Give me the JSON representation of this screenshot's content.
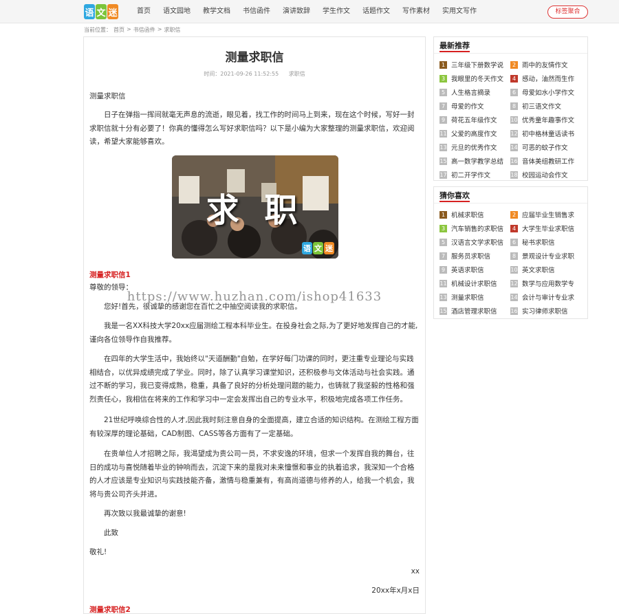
{
  "logo": {
    "chars": [
      "语",
      "文",
      "迷"
    ],
    "colors": [
      "#2fa8e0",
      "#7cc43a",
      "#f08a24"
    ]
  },
  "nav": {
    "items": [
      "首页",
      "语文园地",
      "教学文档",
      "书信函件",
      "演讲致辞",
      "学生作文",
      "话题作文",
      "写作素材",
      "实用文写作"
    ],
    "login_label": "标签聚合"
  },
  "breadcrumb": {
    "prefix": "当前位置：",
    "items": [
      "首页",
      "书信函件",
      "求职信"
    ],
    "sep": ">"
  },
  "article": {
    "title": "测量求职信",
    "time": "时间：2021-09-26 11:52:55",
    "category": "求职信",
    "intro_title": "测量求职信",
    "intro": "日子在弹指一挥间就毫无声息的流逝，眼见着，找工作的时间马上到来，现在这个时候，写好一封求职信就十分有必要了！你真的懂得怎么写好求职信吗？以下是小编为大家整理的测量求职信，欢迎阅读，希望大家能够喜欢。",
    "hero_text": "求 职",
    "section1_title": "测量求职信1",
    "salutation": "尊敬的领导：",
    "p1": "您好!首先，很诚挚的感谢您在百忙之中抽空阅读我的求职信。",
    "p2": "我是一名XX科技大学20xx应届测绘工程本科毕业生。在投身社会之际,为了更好地发挥自己的才能,谨向各位领导作自我推荐。",
    "p3": "在四年的大学生活中，我始终以\"天道酬勤\"自勉，在学好每门功课的同时，更注重专业理论与实践相结合，以优异成绩完成了学业。同时，除了认真学习课堂知识，还积极参与文体活动与社会实践。通过不断的学习，我已变得成熟，稳重，具备了良好的分析处理问题的能力，也铸就了我坚毅的性格和强烈责任心，我相信在将来的工作和学习中一定会发挥出自己的专业水平，积极地完成各项工作任务。",
    "p4": "21世纪呼唤综合性的人才,因此我时刻注意自身的全面提高，建立合适的知识结构。在测绘工程方面有较深厚的理论基础，CAD制图、CASS等各方面有了一定基础。",
    "p5": "在贵单位人才招聘之际，我渴望成为贵公司一员，不求安逸的环境，但求一个发挥自我的舞台，往日的成功与喜悦随着毕业的钟响而去，沉淀下来的是我对未来憧憬和事业的执着追求，我深知一个合格的人才应该是专业知识与实践技能齐备，激情与稳重兼有，有高尚道德与修养的人，给我一个机会，我将与贵公司齐头并进。",
    "p6": "再次致以我最诚挚的谢意!",
    "p7": "此致",
    "p8": "敬礼!",
    "sign": "xx",
    "date": "20xx年x月x日",
    "section2_title": "测量求职信2",
    "watermark": "https://www.huzhan.com/ishop41633"
  },
  "sidebar": {
    "latest_title": "最新推荐",
    "latest": [
      "三年级下册数学说",
      "雨中的友情作文",
      "我眼里的冬天作文",
      "感动，油然而生作",
      "人生格言摘录",
      "母爱如水小学作文",
      "母爱的作文",
      "初三语文作文",
      "荷花五年级作文",
      "优秀童年趣事作文",
      "父爱的高度作文",
      "初中格林童话读书",
      "元旦的优秀作文",
      "可恶的蚊子作文",
      "高一数学教学总结",
      "音体美组教研工作",
      "初二开学作文",
      "校园运动会作文"
    ],
    "guess_title": "猜你喜欢",
    "guess": [
      "机械求职信",
      "应届毕业生销售求",
      "汽车销售的求职信",
      "大学生毕业求职信",
      "汉语言文学求职信",
      "秘书求职信",
      "服务员求职信",
      "景观设计专业求职",
      "英语求职信",
      "英文求职信",
      "机械设计求职信",
      "数学与应用数学专",
      "测量求职信",
      "会计与审计专业求",
      "酒店管理求职信",
      "实习律师求职信"
    ],
    "rank_colors": {
      "1": "#8a5a1e",
      "2": "#f08a24",
      "3": "#8cc63f",
      "4": "#c0392b",
      "other": "#bbbbbb"
    }
  }
}
